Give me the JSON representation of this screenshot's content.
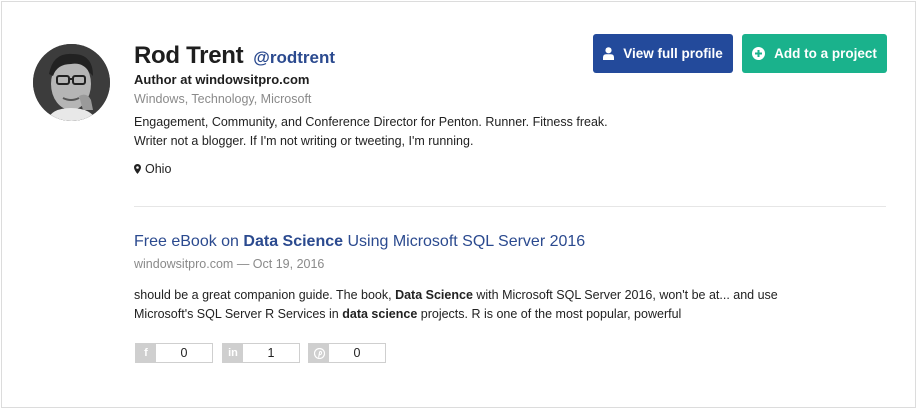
{
  "profile": {
    "name": "Rod Trent",
    "handle": "@rodtrent",
    "role": "Author at windowsitpro.com",
    "tags": "Windows, Technology, Microsoft",
    "bio_line1": "Engagement, Community, and Conference Director for Penton. Runner. Fitness freak.",
    "bio_line2": "Writer not a blogger. If I'm not writing or tweeting, I'm running.",
    "location": "Ohio",
    "avatar_icon": "user-photo"
  },
  "actions": {
    "view_profile_label": "View full profile",
    "add_project_label": "Add to a project",
    "primary_color": "#234a9b",
    "success_color": "#1ab28c"
  },
  "article": {
    "title_part1": "Free eBook on ",
    "title_bold": "Data Science",
    "title_part2": " Using Microsoft SQL Server 2016",
    "source": "windowsitpro.com",
    "date_sep": " — ",
    "date": "Oct 19, 2016",
    "snippet_l1_a": "should be a great companion guide. The book, ",
    "snippet_l1_bold": "Data Science",
    "snippet_l1_b": " with Microsoft SQL Server 2016, won't be at... and use",
    "snippet_l2_a": "Microsoft's SQL Server R Services in ",
    "snippet_l2_bold": "data science",
    "snippet_l2_b": " projects. R is one of the most popular, powerful"
  },
  "shares": [
    {
      "network": "facebook",
      "icon": "f",
      "count": "0"
    },
    {
      "network": "linkedin",
      "icon": "in",
      "count": "1"
    },
    {
      "network": "pinterest",
      "icon": "p",
      "count": "0"
    }
  ]
}
